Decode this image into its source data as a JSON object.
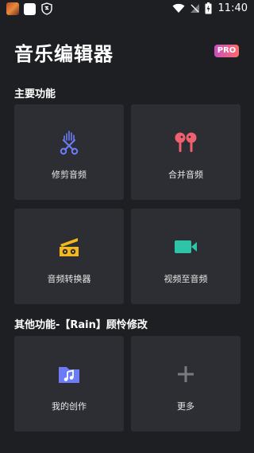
{
  "status_bar": {
    "time": "11:40"
  },
  "app": {
    "title": "音乐编辑器",
    "pro_badge": "PRO"
  },
  "sections": [
    {
      "title": "主要功能",
      "cards": [
        {
          "label": "修剪音频",
          "icon": "scissors-waveform-icon",
          "color": "#6b7cf6"
        },
        {
          "label": "合并音频",
          "icon": "earbuds-icon",
          "color": "#f0606e"
        },
        {
          "label": "音频转换器",
          "icon": "convert-icon",
          "color": "#f5b81c"
        },
        {
          "label": "视频至音频",
          "icon": "video-camera-icon",
          "color": "#2ec4a8"
        }
      ]
    },
    {
      "title": "其他功能-【Rain】顾怜修改",
      "cards": [
        {
          "label": "我的创作",
          "icon": "music-folder-icon",
          "color": "#6b7cf6"
        },
        {
          "label": "更多",
          "icon": "plus-icon",
          "color": "#7a7b80"
        }
      ]
    }
  ]
}
